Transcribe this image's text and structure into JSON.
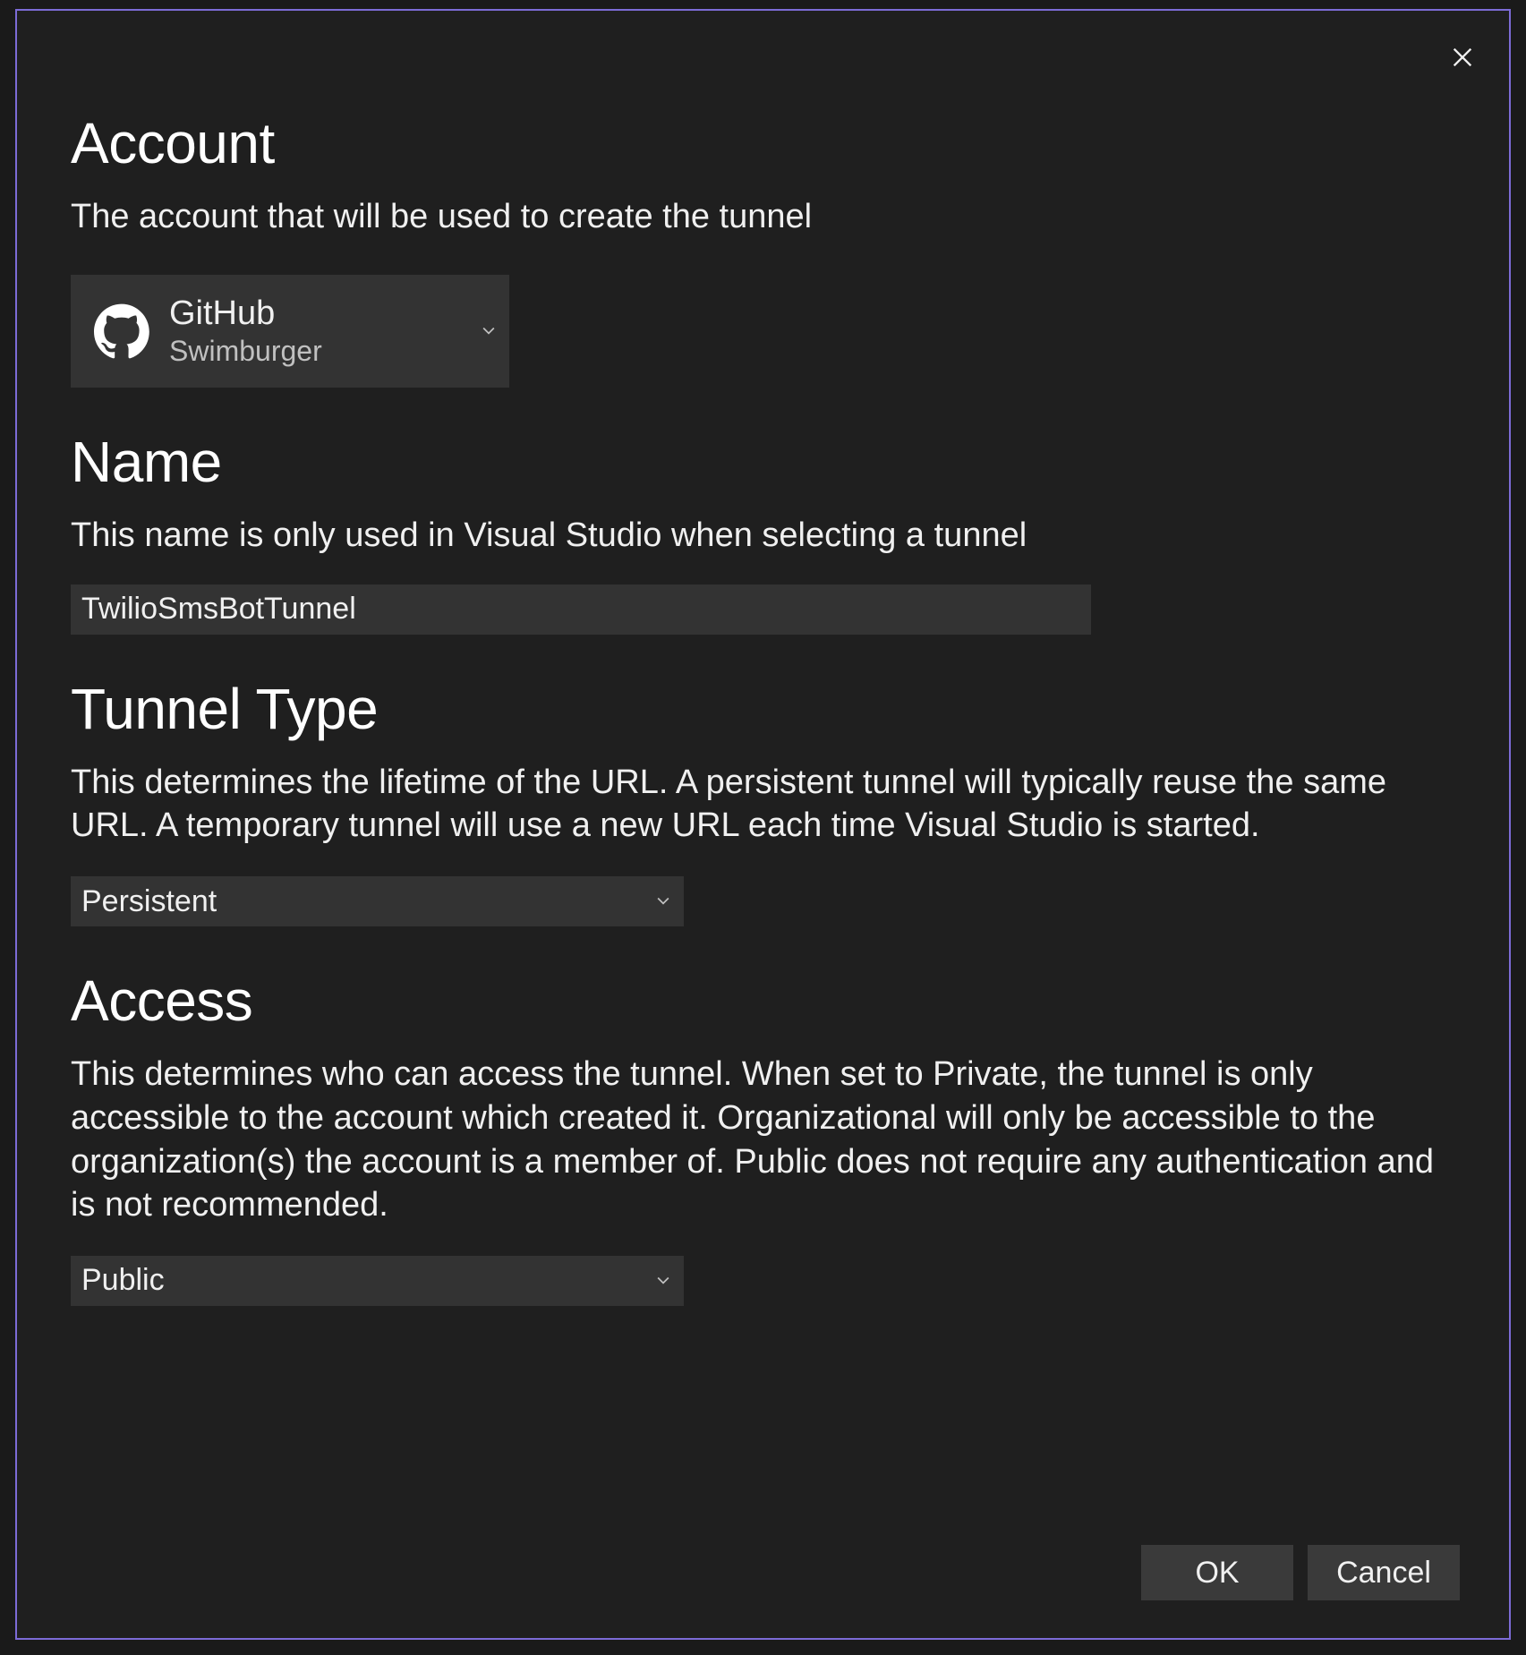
{
  "dialog": {
    "close_label": "Close"
  },
  "account": {
    "title": "Account",
    "description": "The account that will be used to create the tunnel",
    "provider": "GitHub",
    "username": "Swimburger",
    "icon": "github-icon"
  },
  "name": {
    "title": "Name",
    "description": "This name is only used in Visual Studio when selecting a tunnel",
    "value": "TwilioSmsBotTunnel"
  },
  "tunnel_type": {
    "title": "Tunnel Type",
    "description": "This determines the lifetime of the URL. A persistent tunnel will typically reuse the same URL. A temporary tunnel will use a new URL each time Visual Studio is started.",
    "selected": "Persistent"
  },
  "access": {
    "title": "Access",
    "description": "This determines who can access the tunnel. When set to Private, the tunnel is only accessible to the account which created it. Organizational will only be accessible to the organization(s) the account is a member of. Public does not require any authentication and is not recommended.",
    "selected": "Public"
  },
  "buttons": {
    "ok": "OK",
    "cancel": "Cancel"
  }
}
